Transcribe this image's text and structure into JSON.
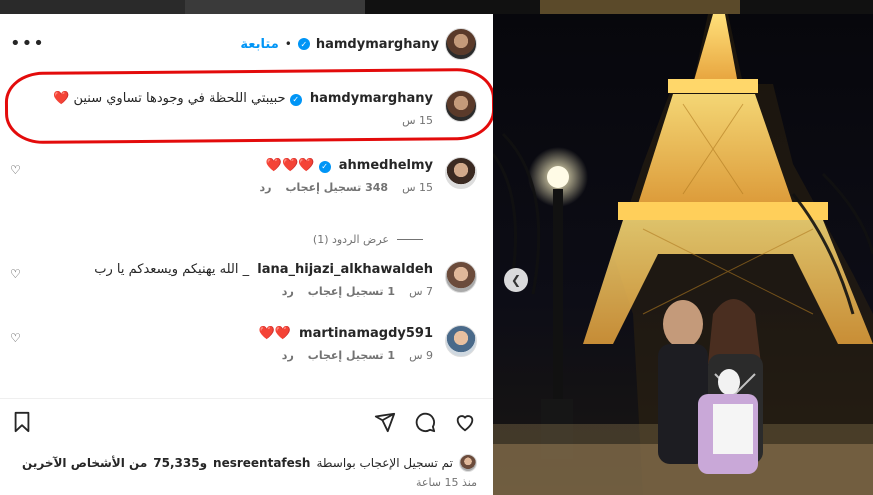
{
  "post": {
    "author": "hamdymarghany",
    "follow_label": "متابعة",
    "dot": "•",
    "more": "•••"
  },
  "caption": {
    "user": "hamdymarghany",
    "text": "حبيبتي اللحظة في وجودها تساوي سنين",
    "emoji": "❤️",
    "time": "15 س"
  },
  "comments": [
    {
      "user": "ahmedhelmy",
      "verified": true,
      "text": "❤️❤️❤️",
      "time": "15 س",
      "likes": "348 تسجيل إعجاب",
      "reply": "رد",
      "view_replies": "عرض الردود (1)"
    },
    {
      "user": "lana_hijazi_alkhawaldeh",
      "text": "_ الله يهنيكم ويسعدكم يا رب",
      "time": "7 س",
      "likes": "1 تسجيل إعجاب",
      "reply": "رد"
    },
    {
      "user": "martinamagdy591",
      "text": "❤️❤️",
      "time": "9 س",
      "likes": "1 تسجيل إعجاب",
      "reply": "رد"
    }
  ],
  "likes_summary": {
    "prefix": "تم تسجيل الإعجاب بواسطة",
    "user": "nesreentafesh",
    "middle": "و75,335",
    "suffix": "من الأشخاص الآخرين",
    "time_ago": "منذ 15 ساعة"
  },
  "icons": {
    "heart": "heart-icon",
    "comment": "comment-icon",
    "share": "share-icon",
    "save": "bookmark-icon",
    "verified": "verified-badge-icon",
    "more": "more-options-icon",
    "prev": "chevron-left-icon"
  },
  "colors": {
    "link_blue": "#0095f6",
    "highlight_red": "#e30b0b",
    "heart_red": "#e0242f"
  }
}
